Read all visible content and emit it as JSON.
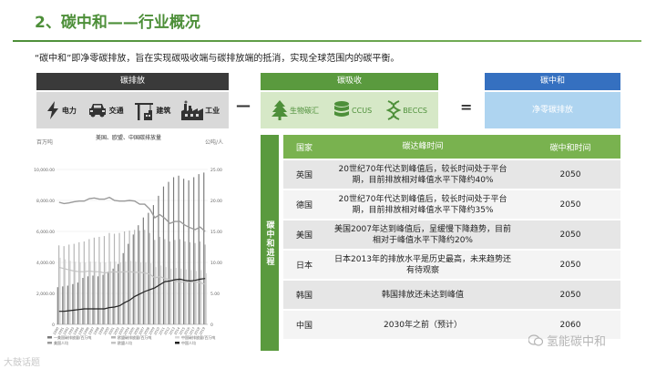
{
  "slide": {
    "title": "2、碳中和——行业概况",
    "intro": "“碳中和”即净零碳排放，旨在实现碳吸收端与碳排放端的抵消，实现全球范围内的碳平衡。"
  },
  "emission": {
    "header": "碳排放",
    "items": [
      {
        "label": "电力",
        "icon": "lightning-icon"
      },
      {
        "label": "交通",
        "icon": "car-icon"
      },
      {
        "label": "建筑",
        "icon": "crane-icon"
      },
      {
        "label": "工业",
        "icon": "factory-icon"
      }
    ]
  },
  "absorption": {
    "header": "碳吸收",
    "items": [
      {
        "label": "生物碳汇",
        "icon": "tree-icon"
      },
      {
        "label": "CCUS",
        "icon": "database-icon"
      },
      {
        "label": "BECCS",
        "icon": "dna-icon"
      }
    ]
  },
  "neutral": {
    "header": "碳中和",
    "body": "净零碳排放"
  },
  "operators": {
    "minus": "—",
    "equal": "="
  },
  "chart_data": {
    "type": "bar",
    "title": "美国、欧盟、中国碳排放量",
    "ylabel_left": "百万吨",
    "ylabel_right": "公吨/人",
    "yticks_left": [
      "0",
      "2,000.00",
      "4,000.00",
      "6,000.00",
      "8,000.00",
      "10,000.00"
    ],
    "yticks_right": [
      "0",
      "5.00",
      "10.00",
      "15.00",
      "20.00",
      "25.00"
    ],
    "ylim_left": [
      0,
      10000
    ],
    "ylim_right": [
      0,
      25
    ],
    "categories": [
      "1990",
      "1991",
      "1992",
      "1993",
      "1994",
      "1995",
      "1996",
      "1997",
      "1998",
      "1999",
      "2000",
      "2001",
      "2002",
      "2003",
      "2004",
      "2005",
      "2006",
      "2007",
      "2008",
      "2009",
      "2010",
      "2011",
      "2012",
      "2013",
      "2014",
      "2015",
      "2016",
      "2017",
      "2018",
      "2019"
    ],
    "series": [
      {
        "kind": "bar",
        "values": [
          2400,
          2450,
          2500,
          2600,
          2700,
          3000,
          3100,
          3150,
          3100,
          3200,
          3400,
          3600,
          3900,
          4600,
          5200,
          5800,
          6400,
          6900,
          7200,
          7700,
          8300,
          8900,
          9200,
          9500,
          9600,
          9400,
          9300,
          9500,
          9700,
          9800
        ]
      },
      {
        "kind": "bar",
        "values": [
          5100,
          5050,
          5150,
          5200,
          5300,
          5350,
          5500,
          5600,
          5650,
          5700,
          5900,
          5850,
          5900,
          6000,
          6050,
          6100,
          6050,
          6100,
          5900,
          5450,
          5650,
          5500,
          5350,
          5450,
          5500,
          5350,
          5300,
          5250,
          5350,
          5150
        ]
      },
      {
        "kind": "bar",
        "values": [
          4300,
          4200,
          4100,
          4050,
          4000,
          4000,
          4050,
          4050,
          4000,
          4000,
          4050,
          4050,
          4000,
          4050,
          4100,
          4050,
          4000,
          4000,
          3950,
          3700,
          3800,
          3700,
          3600,
          3650,
          3600,
          3550,
          3500,
          3450,
          3500,
          3300
        ]
      },
      {
        "kind": "line",
        "values": [
          19.7,
          19.5,
          19.6,
          19.8,
          19.9,
          19.9,
          20.3,
          20.4,
          20.2,
          20.2,
          20.5,
          20.0,
          19.9,
          19.9,
          20.0,
          19.9,
          19.4,
          19.4,
          18.6,
          17.2,
          17.7,
          17.1,
          16.3,
          16.6,
          16.6,
          16.0,
          15.6,
          15.3,
          15.7,
          15.0
        ]
      },
      {
        "kind": "line",
        "values": [
          9.2,
          9.0,
          8.8,
          8.6,
          8.5,
          8.5,
          8.6,
          8.5,
          8.5,
          8.3,
          8.4,
          8.5,
          8.4,
          8.5,
          8.5,
          8.4,
          8.4,
          8.3,
          8.1,
          7.5,
          7.7,
          7.4,
          7.2,
          7.0,
          6.8,
          6.9,
          6.8,
          6.9,
          6.7,
          6.5
        ]
      },
      {
        "kind": "line",
        "values": [
          2.1,
          2.1,
          2.2,
          2.3,
          2.4,
          2.5,
          2.5,
          2.5,
          2.5,
          2.5,
          2.7,
          2.8,
          3.0,
          3.5,
          3.9,
          4.5,
          4.9,
          5.3,
          5.6,
          5.9,
          6.4,
          6.9,
          7.0,
          7.2,
          7.3,
          7.1,
          7.0,
          7.1,
          7.3,
          7.4
        ]
      }
    ],
    "legend": [
      "一美国碳排放量/百万吨",
      "欧盟碳排放量/百万吨",
      "中国碳排放量/百万吨",
      "美国人均",
      "欧盟人均",
      "中国人均"
    ]
  },
  "section_label": "碳中和进程",
  "table": {
    "headers": [
      "国家",
      "碳达峰时间",
      "碳中和时间"
    ],
    "rows": [
      {
        "country": "英国",
        "peak": "20世纪70年代达到峰值后，较长时间处于平台期，目前排放相对峰值水平下降约40%",
        "neutral": "2050"
      },
      {
        "country": "德国",
        "peak": "20世纪70年代达到峰值后，较长时间处于平台期，目前排放相对峰值水平下降约35%",
        "neutral": "2050"
      },
      {
        "country": "美国",
        "peak": "美国2007年达到峰值后，呈缓慢下降趋势，目前相对于峰值水平下降约20%",
        "neutral": "2050"
      },
      {
        "country": "日本",
        "peak": "日本2013年的排放水平是历史最高，未来趋势还有待观察",
        "neutral": "2050"
      },
      {
        "country": "韩国",
        "peak": "韩国排放还未达到峰值",
        "neutral": "2050"
      },
      {
        "country": "中国",
        "peak": "2030年之前（预计）",
        "neutral": "2060"
      }
    ]
  },
  "watermarks": {
    "left": "大鼓话题",
    "right": "氢能碳中和"
  }
}
